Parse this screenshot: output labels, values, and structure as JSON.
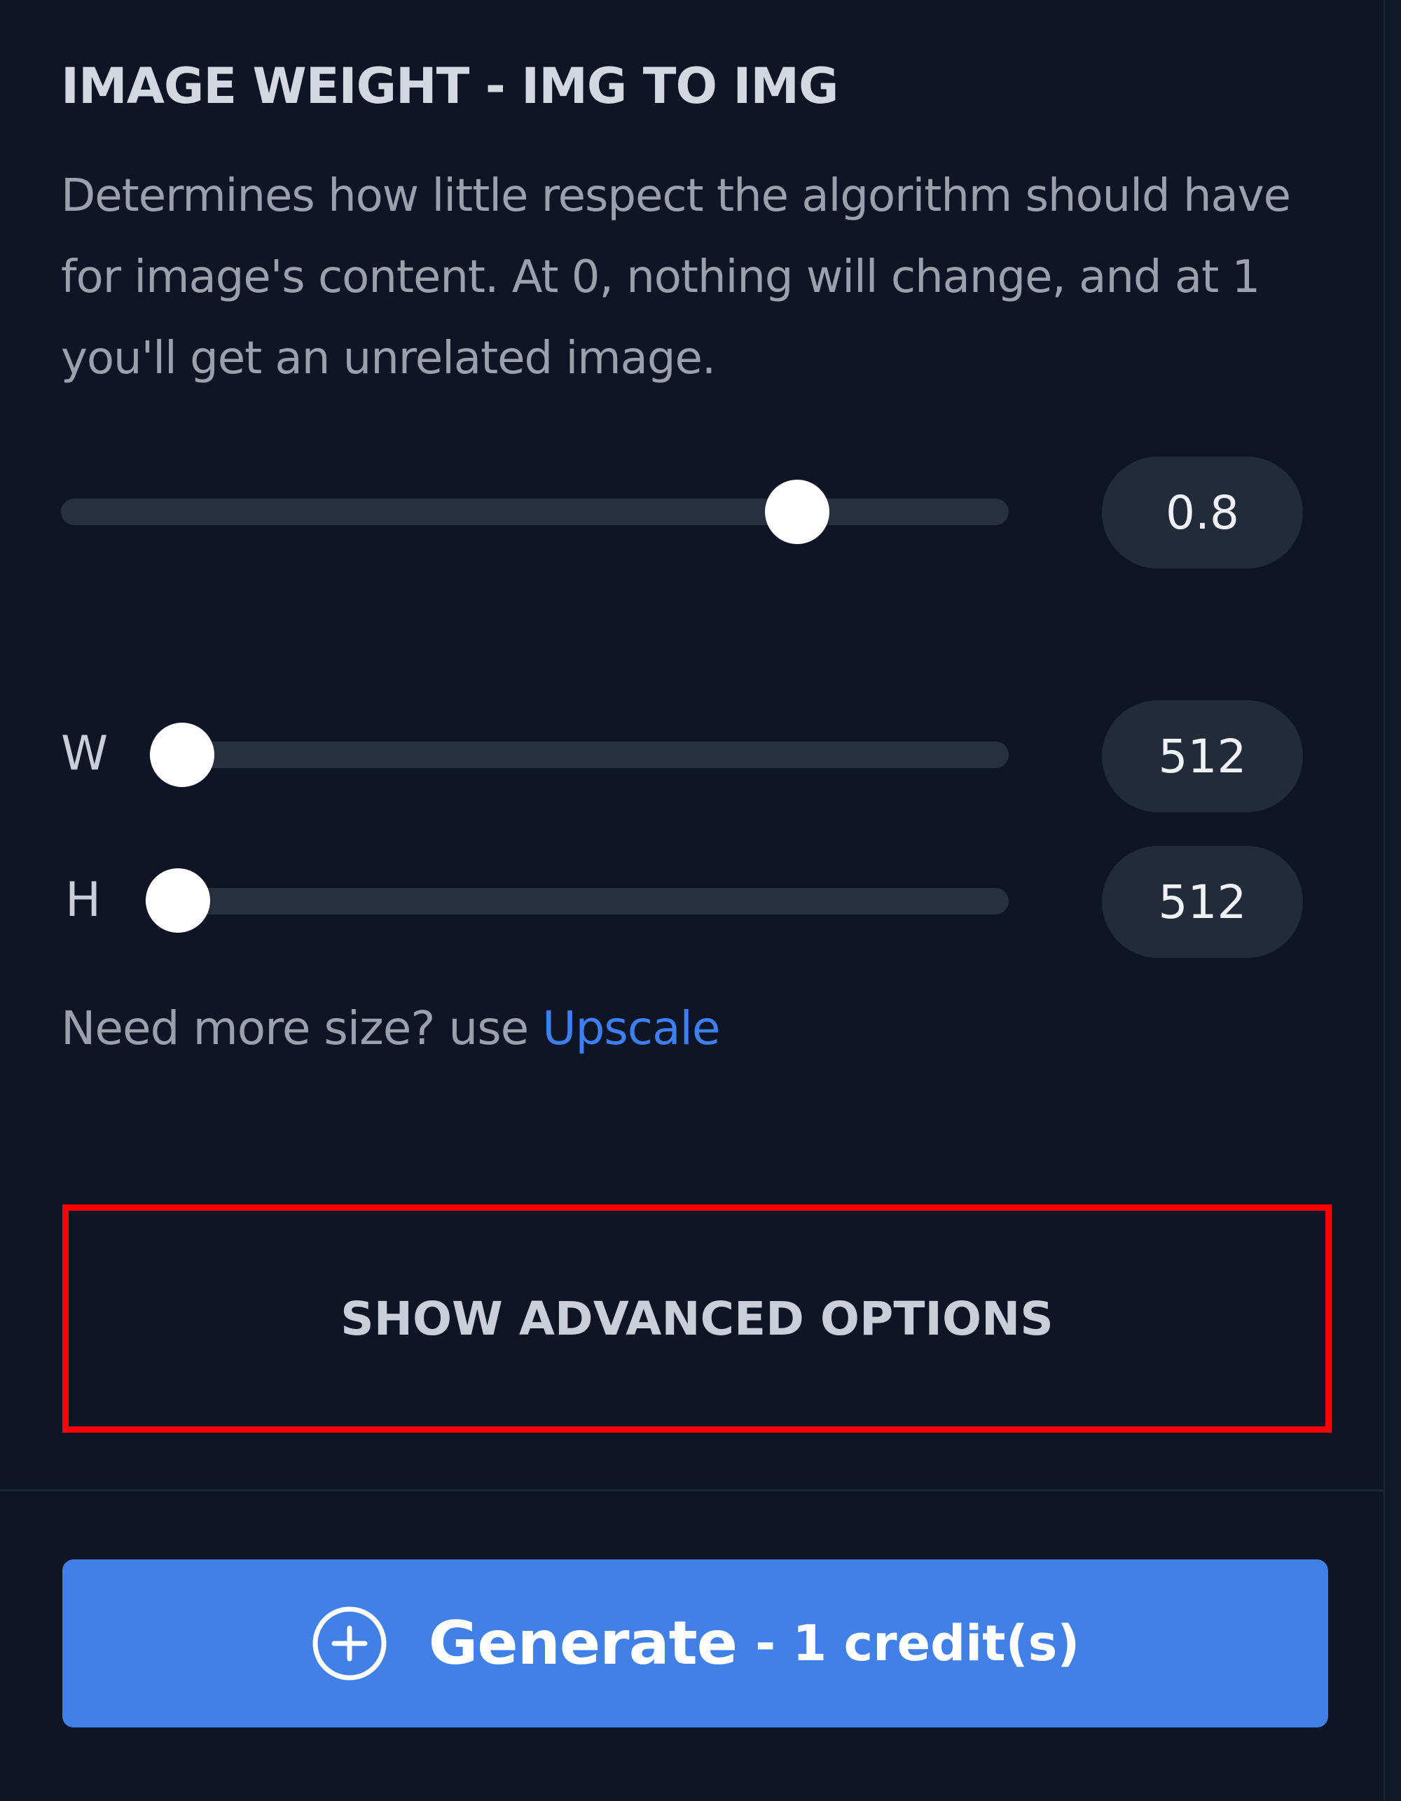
{
  "image_weight": {
    "title": "IMAGE WEIGHT - IMG TO IMG",
    "description": "Determines how little respect the algorithm should have for image's content. At 0, nothing will change, and at 1 you'll get an unrelated image.",
    "slider_value": 0.8,
    "value_display": "0.8"
  },
  "dimensions": {
    "width_label": "W",
    "width_value": "512",
    "height_label": "H",
    "height_value": "512"
  },
  "upscale_hint": {
    "text": "Need more size? use ",
    "link_label": "Upscale"
  },
  "advanced": {
    "button_label": "SHOW ADVANCED OPTIONS"
  },
  "generate": {
    "label": "Generate",
    "credits_label": "- 1 credit(s)"
  },
  "colors": {
    "background": "#0e1626",
    "accent_blue": "#4180e6",
    "link_blue": "#3f7ff5",
    "highlight_red": "#ff0000"
  }
}
